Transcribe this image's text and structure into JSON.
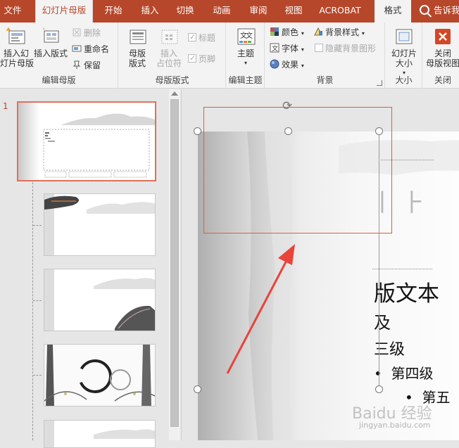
{
  "tabs": [
    {
      "label": "文件"
    },
    {
      "label": "幻灯片母版"
    },
    {
      "label": "开始"
    },
    {
      "label": "插入"
    },
    {
      "label": "切换"
    },
    {
      "label": "动画"
    },
    {
      "label": "审阅"
    },
    {
      "label": "视图"
    },
    {
      "label": "ACROBAT"
    },
    {
      "label": "格式"
    }
  ],
  "tellme": "告诉我",
  "groups": {
    "edit_master": {
      "label": "编辑母版",
      "insert_master": "插入幻灯片母版",
      "insert_master_l1": "插入幻",
      "insert_master_l2": "灯片母版",
      "insert_layout": "插入版式",
      "delete": "删除",
      "rename": "重命名",
      "preserve": "保留"
    },
    "master_layout": {
      "label": "母版版式",
      "master_layout_l1": "母版",
      "master_layout_l2": "版式",
      "insert_placeholder_l1": "插入",
      "insert_placeholder_l2": "占位符",
      "title": "标题",
      "footer": "页脚"
    },
    "edit_theme": {
      "label": "编辑主题",
      "theme": "主题"
    },
    "background": {
      "label": "背景",
      "colors": "颜色",
      "fonts": "字体",
      "effects": "效果",
      "bg_styles": "背景样式",
      "hide_bg": "隐藏背景图形"
    },
    "size": {
      "label": "大小",
      "slide_size_l1": "幻灯片",
      "slide_size_l2": "大小"
    },
    "close": {
      "label": "关闭",
      "close_l1": "关闭",
      "close_l2": "母版视图"
    }
  },
  "slide_number": "1",
  "slide_text": {
    "title_part": "版文本",
    "level2": "及",
    "level3": "三级",
    "level4": "第四级",
    "level5": "第五"
  },
  "watermark": "Baidu 经验",
  "watermark_url": "jingyan.baidu.com",
  "colors": {
    "accent": "#b7472a",
    "annotation": "#e05a45"
  }
}
